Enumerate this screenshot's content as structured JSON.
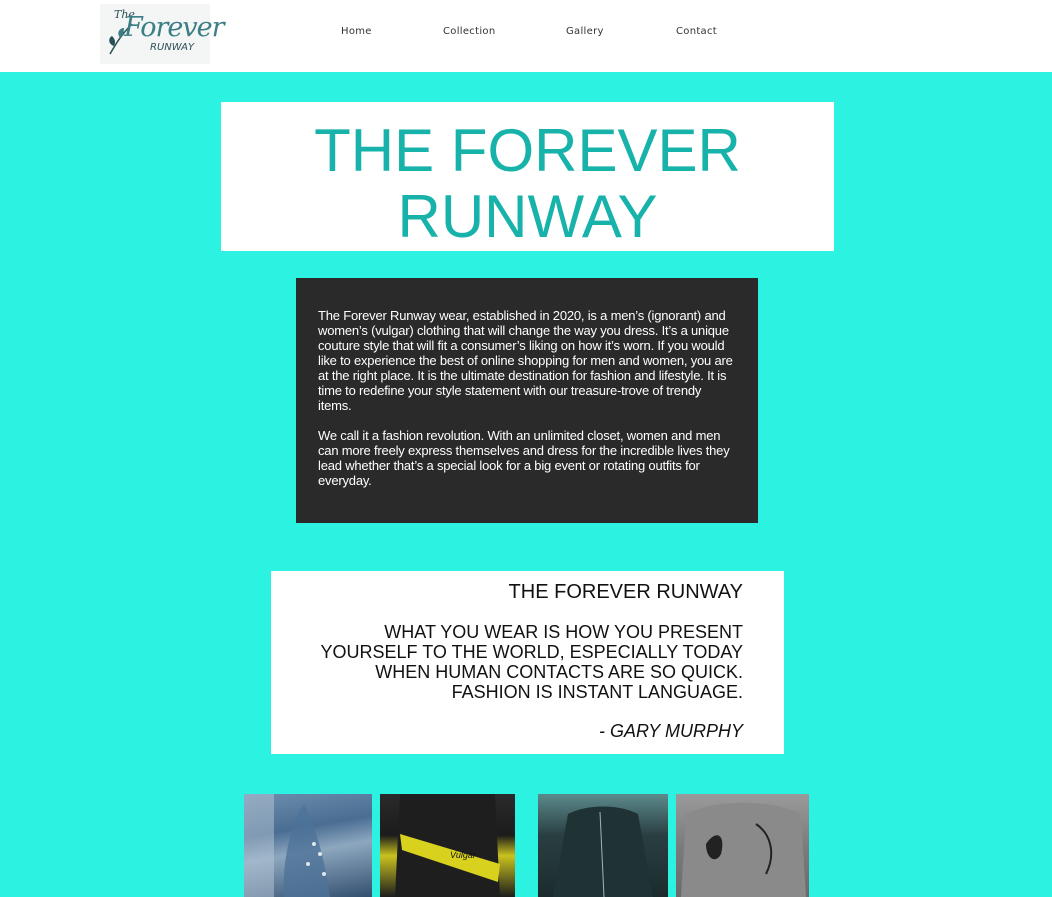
{
  "header": {
    "logo": {
      "the": "The",
      "forever": "Forever",
      "runway": "RUNWAY"
    },
    "nav": [
      {
        "label": "Home"
      },
      {
        "label": "Collection"
      },
      {
        "label": "Gallery"
      },
      {
        "label": "Contact"
      }
    ]
  },
  "hero": {
    "title_line1": "THE FOREVER",
    "title_line2": "RUNWAY"
  },
  "about": {
    "paragraph1": "The Forever Runway wear, established in 2020, is a men’s (ignorant) and women’s (vulgar) clothing that will change the way you dress. It’s a unique couture style that will fit a consumer’s liking on how it’s worn. If you would like to experience the best of online shopping for men and women, you are at the right place. It is the ultimate destination for fashion and lifestyle. It is time to redefine your style statement with our treasure-trove of trendy items.",
    "paragraph2": "We call it a fashion revolution. With an unlimited closet, women and men can more freely express themselves and dress for the incredible lives they lead whether that’s a special look for a big event or rotating outfits for everyday."
  },
  "quote": {
    "title": "THE FOREVER RUNWAY",
    "body": "WHAT YOU WEAR IS HOW YOU PRESENT YOURSELF TO THE WORLD, ESPECIALLY TODAY WHEN HUMAN CONTACTS ARE SO QUICK. FASHION IS INSTANT LANGUAGE.",
    "author": "- GARY MURPHY"
  },
  "gallery": {
    "items": [
      {
        "alt": "jeans-photo"
      },
      {
        "alt": "vulgar-skirt-photo",
        "caption": "Vulgar"
      },
      {
        "alt": "leather-jacket-photo"
      },
      {
        "alt": "printed-shirt-photo"
      }
    ]
  },
  "colors": {
    "background": "#2cf2e2",
    "accent": "#17b3aa",
    "dark_panel": "#2b2a2a"
  }
}
